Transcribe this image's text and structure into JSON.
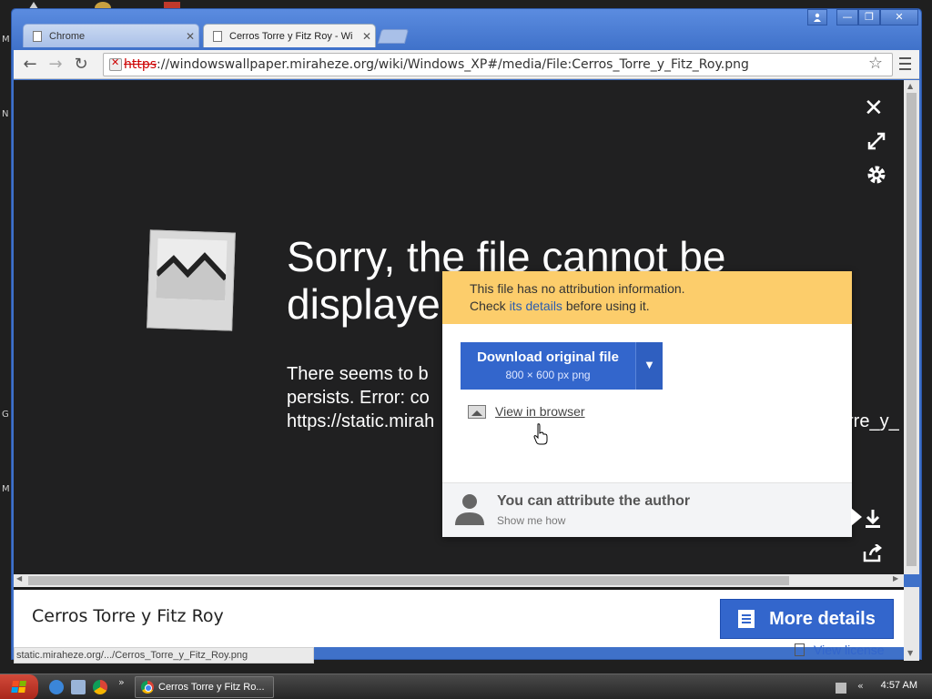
{
  "browser": {
    "tabs": [
      {
        "label": "Chrome",
        "active": false
      },
      {
        "label": "Cerros Torre y Fitz Roy - Wi",
        "active": true
      }
    ],
    "url_scheme": "https",
    "url_rest": "://windowswallpaper.miraheze.org/wiki/Windows_XP#/media/File:Cerros_Torre_y_Fitz_Roy.png"
  },
  "viewer": {
    "error_title_line1": "Sorry, the file cannot be",
    "error_title_line2": "displaye",
    "error_body_line1": "There seems to b",
    "error_body_line2": "persists. Error: co",
    "error_body_line3": "https://static.mirah",
    "error_body_overflow": "rre_y_",
    "close_icon": "close-icon",
    "fullscreen_icon": "expand-icon",
    "settings_icon": "gear-icon"
  },
  "popup": {
    "warning_line1": "This file has no attribution information.",
    "warning_line2_pre": "Check ",
    "warning_link": "its details",
    "warning_line2_post": " before using it.",
    "download_label": "Download original file",
    "download_sub": "800 × 600 px png",
    "view_browser": "View in browser",
    "attribute_title": "You can attribute the author",
    "attribute_sub": "Show me how"
  },
  "infobar": {
    "file_title": "Cerros Torre y Fitz Roy",
    "more_details": "More details",
    "view_license": "View license"
  },
  "status_bar": "static.miraheze.org/.../Cerros_Torre_y_Fitz_Roy.png",
  "taskbar": {
    "task_label": "Cerros Torre y Fitz Ro...",
    "tray_arrows": "«",
    "clock": "4:57 AM"
  },
  "desktop_letters": [
    "M",
    "N",
    "G",
    "M"
  ],
  "colors": {
    "accent_blue": "#3366cc",
    "warning_yellow": "#fccd6b",
    "viewer_bg": "#202021"
  }
}
